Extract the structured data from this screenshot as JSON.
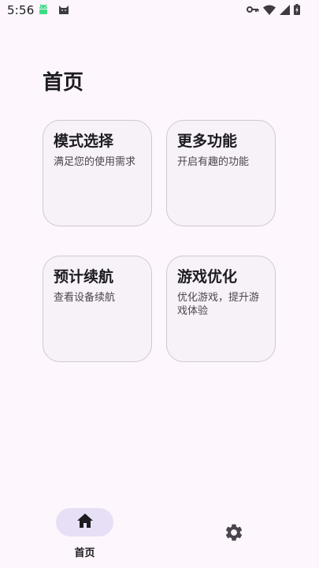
{
  "status_bar": {
    "time": "5:56",
    "left_icons": [
      "android-debug-icon",
      "cat-app-icon"
    ],
    "right_icons": [
      "vpn-key-icon",
      "wifi-icon",
      "signal-icon",
      "battery-charging-icon"
    ]
  },
  "page_title": "首页",
  "cards": [
    {
      "title": "模式选择",
      "desc": "满足您的使用需求"
    },
    {
      "title": "更多功能",
      "desc": "开启有趣的功能"
    },
    {
      "title": "预计续航",
      "desc": "查看设备续航"
    },
    {
      "title": "游戏优化",
      "desc": "优化游戏，提升游戏体验"
    }
  ],
  "bottom_nav": {
    "home_label": "首页",
    "home_icon": "home-icon",
    "settings_icon": "settings-gear-icon",
    "active_indicator_color": "#e7dff6"
  },
  "colors": {
    "background": "#fdf6fc",
    "card_background": "#f7f2f7",
    "card_border": "#cfc9cf"
  }
}
